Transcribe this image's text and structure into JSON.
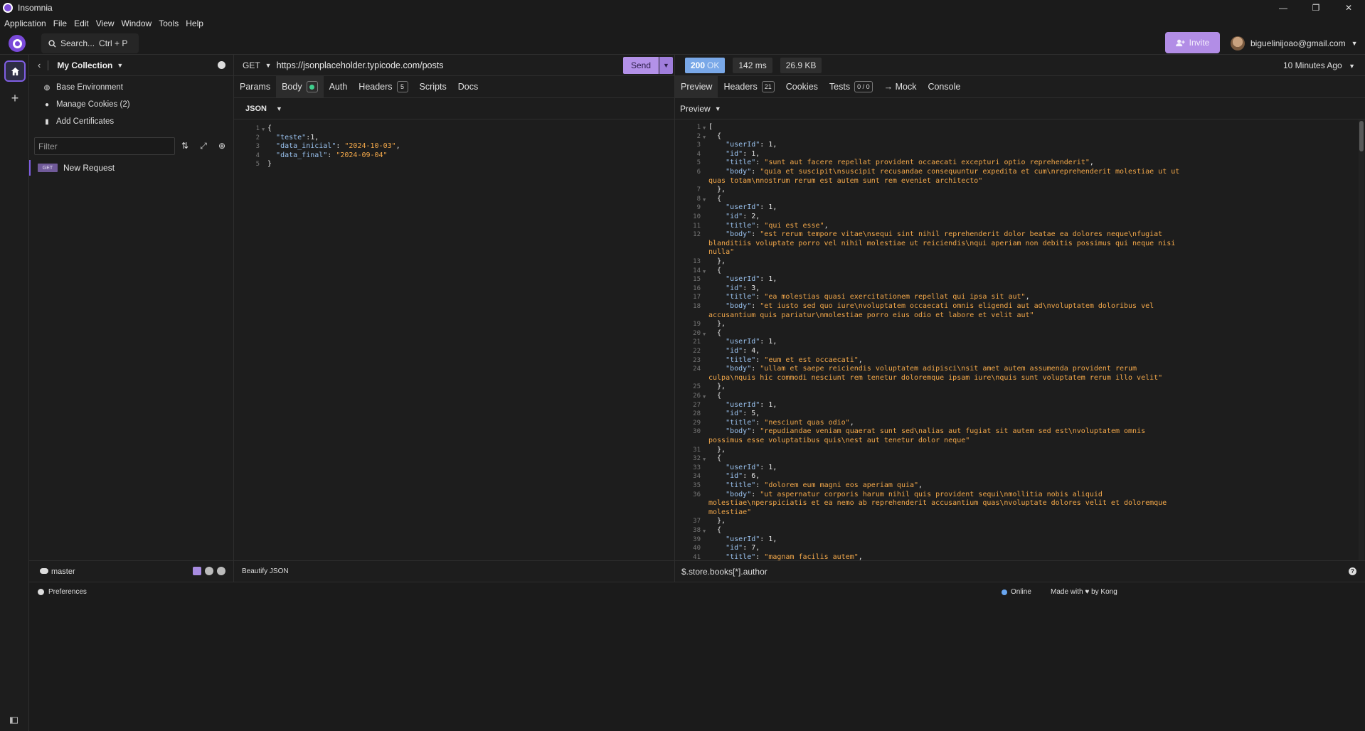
{
  "app": {
    "title": "Insomnia"
  },
  "window_controls": {
    "minimize": "—",
    "restore": "❐",
    "close": "✕"
  },
  "menu": [
    "Application",
    "File",
    "Edit",
    "View",
    "Window",
    "Tools",
    "Help"
  ],
  "header": {
    "search_label": "Search...",
    "search_shortcut": "Ctrl + P",
    "invite_label": "Invite",
    "user_email": "biguelinijoao@gmail.com"
  },
  "rail": {
    "plus": "+"
  },
  "sidebar": {
    "collection_title": "My Collection",
    "items": [
      {
        "label": "Base Environment",
        "icon": "globe-icon"
      },
      {
        "label": "Manage Cookies (2)",
        "icon": "cookie-icon"
      },
      {
        "label": "Add Certificates",
        "icon": "file-icon"
      }
    ],
    "filter_placeholder": "Filter",
    "requests": [
      {
        "method": "GET",
        "name": "New Request"
      }
    ],
    "branch": "master"
  },
  "request": {
    "method": "GET",
    "url": "https://jsonplaceholder.typicode.com/posts",
    "send_label": "Send",
    "tabs": {
      "params": "Params",
      "body": "Body",
      "auth": "Auth",
      "headers": "Headers",
      "headers_count": "5",
      "scripts": "Scripts",
      "docs": "Docs"
    },
    "body_type": "JSON",
    "beautify_label": "Beautify JSON",
    "body_lines": [
      [
        [
          "n",
          "{"
        ]
      ],
      [
        [
          "n",
          "  "
        ],
        [
          "k",
          "\"teste\""
        ],
        [
          "n",
          ":1,"
        ]
      ],
      [
        [
          "n",
          "  "
        ],
        [
          "k",
          "\"data_inicial\""
        ],
        [
          "n",
          ": "
        ],
        [
          "s",
          "\"2024-10-03\""
        ],
        [
          "n",
          ","
        ]
      ],
      [
        [
          "n",
          "  "
        ],
        [
          "k",
          "\"data_final\""
        ],
        [
          "n",
          ": "
        ],
        [
          "s",
          "\"2024-09-04\""
        ]
      ],
      [
        [
          "n",
          "}"
        ]
      ]
    ]
  },
  "response": {
    "status_code": "200",
    "status_text": "OK",
    "time": "142 ms",
    "size": "26.9 KB",
    "timestamp": "10 Minutes Ago",
    "tabs": {
      "preview": "Preview",
      "headers": "Headers",
      "headers_count": "21",
      "cookies": "Cookies",
      "tests": "Tests",
      "tests_count": "0 / 0",
      "mock": "→ Mock",
      "console": "Console"
    },
    "preview_mode": "Preview",
    "filter_placeholder": "$.store.books[*].author",
    "posts": [
      {
        "userId": 1,
        "id": 1,
        "title": "sunt aut facere repellat provident occaecati excepturi optio reprehenderit",
        "body": [
          "\"quia et suscipit\\nsuscipit recusandae consequuntur expedita et cum\\nreprehenderit molestiae ut ut",
          "quas totam\\nnostrum rerum est autem sunt rem eveniet architecto\""
        ]
      },
      {
        "userId": 1,
        "id": 2,
        "title": "qui est esse",
        "body": [
          "\"est rerum tempore vitae\\nsequi sint nihil reprehenderit dolor beatae ea dolores neque\\nfugiat",
          "blanditiis voluptate porro vel nihil molestiae ut reiciendis\\nqui aperiam non debitis possimus qui neque nisi",
          "nulla\""
        ]
      },
      {
        "userId": 1,
        "id": 3,
        "title": "ea molestias quasi exercitationem repellat qui ipsa sit aut",
        "body": [
          "\"et iusto sed quo iure\\nvoluptatem occaecati omnis eligendi aut ad\\nvoluptatem doloribus vel",
          "accusantium quis pariatur\\nmolestiae porro eius odio et labore et velit aut\""
        ]
      },
      {
        "userId": 1,
        "id": 4,
        "title": "eum et est occaecati",
        "body": [
          "\"ullam et saepe reiciendis voluptatem adipisci\\nsit amet autem assumenda provident rerum",
          "culpa\\nquis hic commodi nesciunt rem tenetur doloremque ipsam iure\\nquis sunt voluptatem rerum illo velit\""
        ]
      },
      {
        "userId": 1,
        "id": 5,
        "title": "nesciunt quas odio",
        "body": [
          "\"repudiandae veniam quaerat sunt sed\\nalias aut fugiat sit autem sed est\\nvoluptatem omnis",
          "possimus esse voluptatibus quis\\nest aut tenetur dolor neque\""
        ]
      },
      {
        "userId": 1,
        "id": 6,
        "title": "dolorem eum magni eos aperiam quia",
        "body": [
          "\"ut aspernatur corporis harum nihil quis provident sequi\\nmollitia nobis aliquid",
          "molestiae\\nperspiciatis et ea nemo ab reprehenderit accusantium quas\\nvoluptate dolores velit et doloremque",
          "molestiae\""
        ]
      },
      {
        "userId": 1,
        "id": 7,
        "title": "magnam facilis autem",
        "body": []
      }
    ]
  },
  "statusbar": {
    "preferences": "Preferences",
    "online": "Online",
    "made_with": "Made with ♥ by Kong"
  },
  "colors": {
    "accent": "#7f5ee3",
    "send": "#b391e8",
    "status_ok": "#79a8e8",
    "json_key": "#9ac2ef",
    "json_string": "#f3a84a"
  }
}
